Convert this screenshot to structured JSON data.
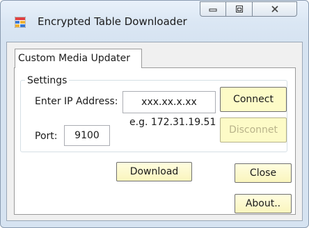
{
  "window": {
    "title": "Encrypted Table Downloader",
    "icon": "app-window-icon",
    "caption_buttons": {
      "minimize_icon": "minimize-icon",
      "maximize_icon": "maximize-icon",
      "close_icon": "close-icon"
    }
  },
  "tab": {
    "label": "Custom Media Updater"
  },
  "settings": {
    "group_label": "Settings",
    "ip_label": "Enter IP Address:",
    "ip_value": "xxx.xx.x.xx",
    "ip_hint": "e.g. 172.31.19.51",
    "port_label": "Port:",
    "port_value": "9100"
  },
  "buttons": {
    "connect": "Connect",
    "disconnect": "Disconnet",
    "download": "Download",
    "close": "Close",
    "about": "About.."
  },
  "colors": {
    "button_yellow": "#fdfbc7",
    "disabled_text": "#b9b38a"
  }
}
